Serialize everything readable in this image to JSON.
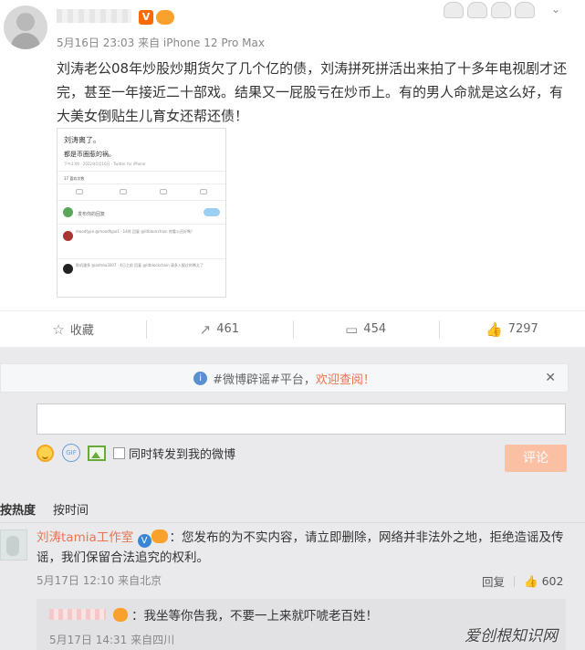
{
  "post": {
    "meta": "5月16日 23:03 来自 iPhone 12 Pro Max",
    "text": "刘涛老公08年炒股炒期货欠了几个亿的债，刘涛拼死拼活出来拍了十多年电视剧才还完，甚至一年接近二十部戏。结果又一屁股亏在炒币上。有的男人命就是这么好，有大美女倒贴生儿育女还帮还债！",
    "verified_badge": "V",
    "embedded": {
      "line1": "刘涛离了。",
      "line2": "都是币圈惹的祸。",
      "line3": "下午2:09 · 2022年5月16日 · Twitter for iPhone",
      "line4": "17 喜欢次数",
      "reply_prompt": "发布你的回复",
      "reply_btn": "回复",
      "c1": "moodfypo @moodfypo1 · 14时 回复 @litblockchain 他看公还好嗎？",
      "c2": "陈机潘多 @antrea3007 · 4日之前 回复 @litblockchain 清多入狠过的嗎太了"
    }
  },
  "actions": [
    {
      "icon": "☆",
      "label": "收藏"
    },
    {
      "icon": "↗",
      "label": "461"
    },
    {
      "icon": "▭",
      "label": "454"
    },
    {
      "icon": "👍",
      "label": "7297"
    }
  ],
  "notice": {
    "prefix": "#微博辟谣#平台，",
    "highlight": "欢迎查阅！"
  },
  "composer": {
    "forward_label": "同时转发到我的微博",
    "submit_label": "评论",
    "gif": "GIF"
  },
  "sort": {
    "hot": "按热度",
    "time": "按时间"
  },
  "comments": [
    {
      "author": "刘涛tamia工作室",
      "text": "：您发布的为不实内容，请立即删除，网络并非法外之地，拒绝造谣及传谣，我们保留合法追究的权利。",
      "meta": "5月17日 12:10 来自北京",
      "reply_label": "回复",
      "likes": "602",
      "reply": {
        "text": "：我坐等你告我，不要一上来就吓唬老百姓！",
        "meta": "5月17日 14:31 来自四川"
      }
    }
  ],
  "watermark": "爱创根知识网"
}
